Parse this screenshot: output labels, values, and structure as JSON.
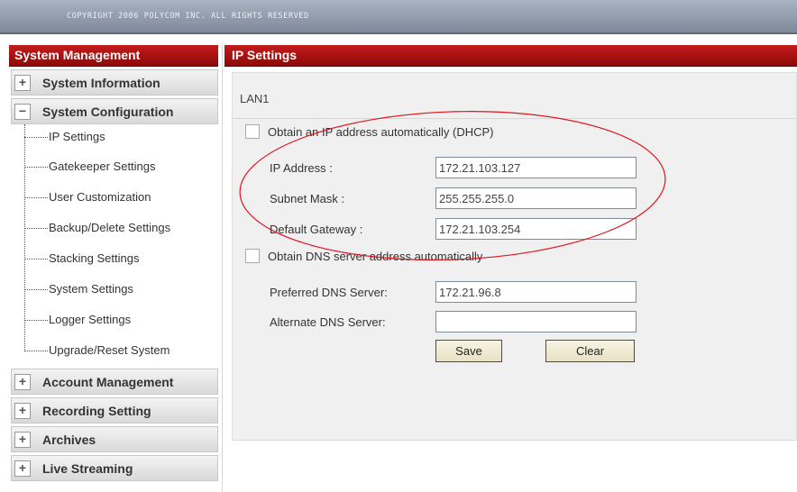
{
  "header": {
    "copyright": "COPYRIGHT 2006 POLYCOM INC. ALL RIGHTS RESERVED"
  },
  "sidebar": {
    "title": "System Management",
    "groups_top": [
      {
        "label": "System Information",
        "toggle": "+"
      },
      {
        "label": "System Configuration",
        "toggle": "−"
      }
    ],
    "sub_items": [
      "IP Settings",
      "Gatekeeper Settings",
      "User Customization",
      "Backup/Delete Settings",
      "Stacking Settings",
      "System Settings",
      "Logger Settings",
      "Upgrade/Reset System"
    ],
    "groups_bottom": [
      {
        "label": "Account Management",
        "toggle": "+"
      },
      {
        "label": "Recording Setting",
        "toggle": "+"
      },
      {
        "label": "Archives",
        "toggle": "+"
      },
      {
        "label": "Live Streaming",
        "toggle": "+"
      }
    ]
  },
  "main": {
    "title": "IP Settings",
    "section": "LAN1",
    "dhcp_label": "Obtain an IP address automatically (DHCP)",
    "dns_auto_label": "Obtain DNS server address automatically",
    "fields": {
      "ip": {
        "label": "IP Address :",
        "value": "172.21.103.127"
      },
      "mask": {
        "label": "Subnet Mask :",
        "value": "255.255.255.0"
      },
      "gateway": {
        "label": "Default Gateway :",
        "value": "172.21.103.254"
      },
      "dns1": {
        "label": "Preferred DNS Server:",
        "value": "172.21.96.8"
      },
      "dns2": {
        "label": "Alternate DNS Server:",
        "value": ""
      }
    },
    "buttons": {
      "save": "Save",
      "clear": "Clear"
    }
  },
  "colors": {
    "header_red": "#b01414",
    "annotation_red": "#e0141e"
  }
}
